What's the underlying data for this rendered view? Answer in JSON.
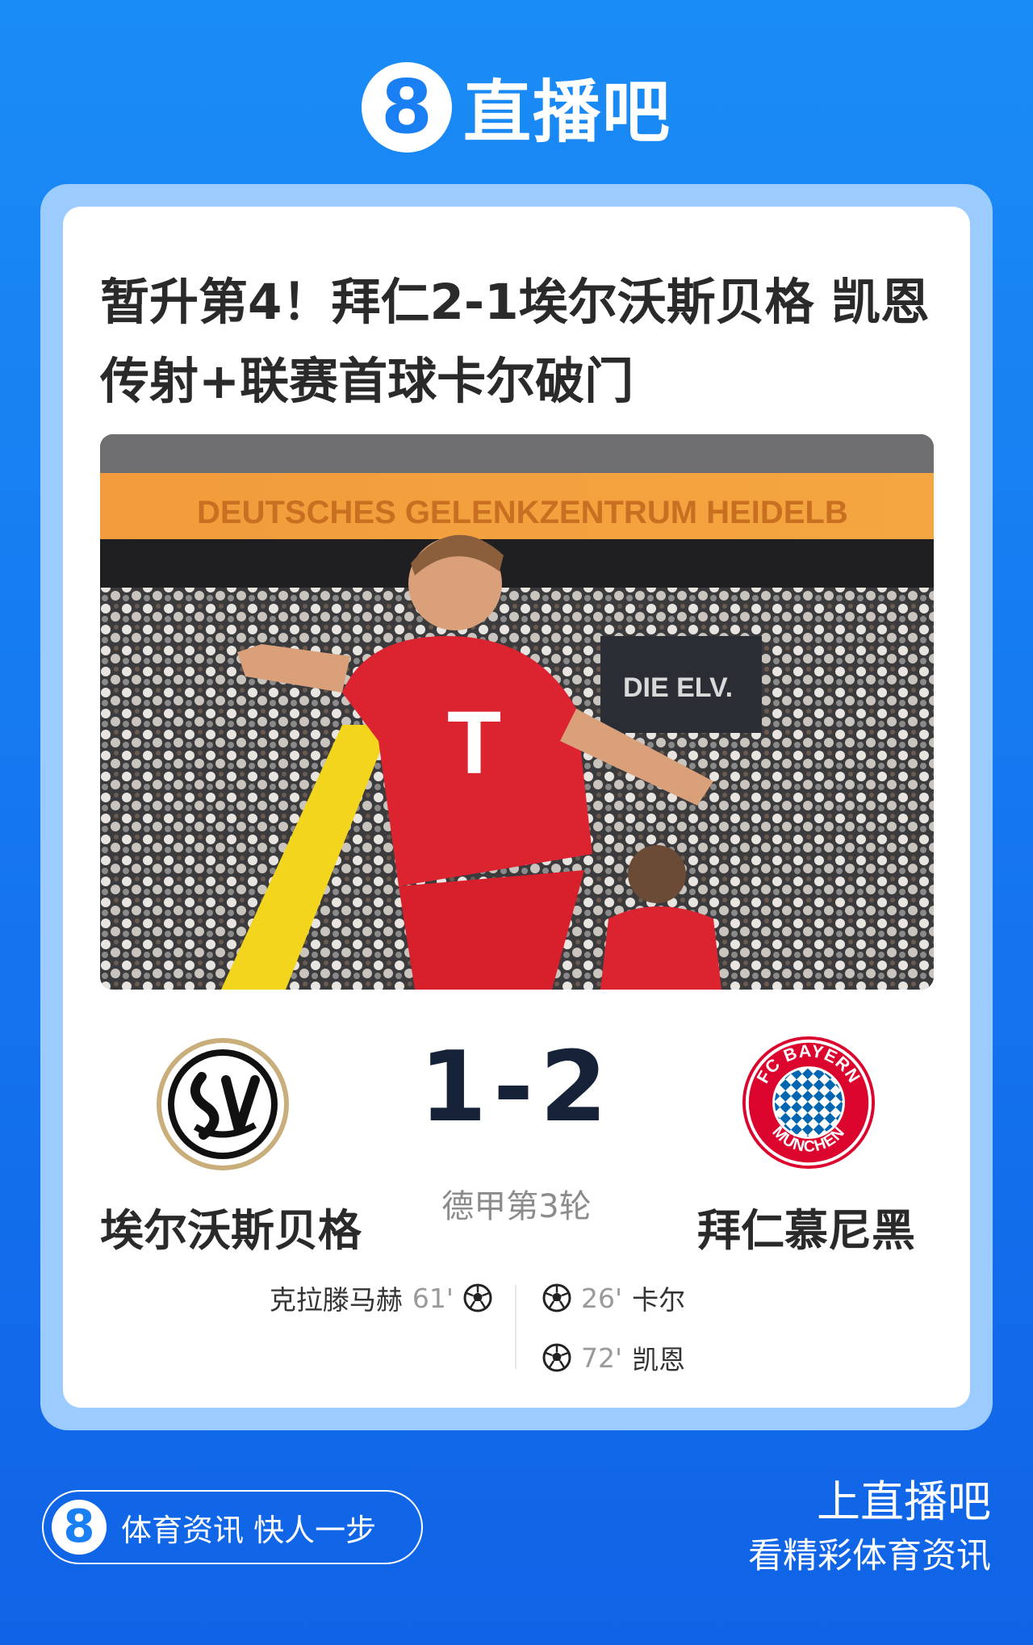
{
  "brand": {
    "badge": "8",
    "name": "直播吧"
  },
  "article": {
    "headline": "暂升第4！拜仁2-1埃尔沃斯贝格 凯恩传射+联赛首球卡尔破门"
  },
  "match": {
    "home_team": "埃尔沃斯贝格",
    "away_team": "拜仁慕尼黑",
    "score": "1-2",
    "competition": "德甲第3轮",
    "home_events": [
      {
        "player": "克拉滕马赫",
        "minute": "61'",
        "icon": "football-icon"
      }
    ],
    "away_events": [
      {
        "player": "卡尔",
        "minute": "26'",
        "icon": "football-icon"
      },
      {
        "player": "凯恩",
        "minute": "72'",
        "icon": "football-icon"
      }
    ]
  },
  "photo": {
    "banner_text": "DEUTSCHES GELENKZENTRUM HEIDELB",
    "board_text": "DIE ELV.",
    "jersey_mark": "T"
  },
  "away_crest": {
    "text_top": "FC BAYERN",
    "text_bottom": "MÜNCHEN"
  },
  "footer": {
    "badge": "8",
    "slogan": "体育资讯 快人一步",
    "cta_title": "上直播吧",
    "cta_subtitle": "看精彩体育资讯"
  },
  "colors": {
    "background": "#1577f0",
    "card_frame": "#9ccbff",
    "bayern_red": "#dc052d",
    "bayern_blue": "#0066b2"
  }
}
